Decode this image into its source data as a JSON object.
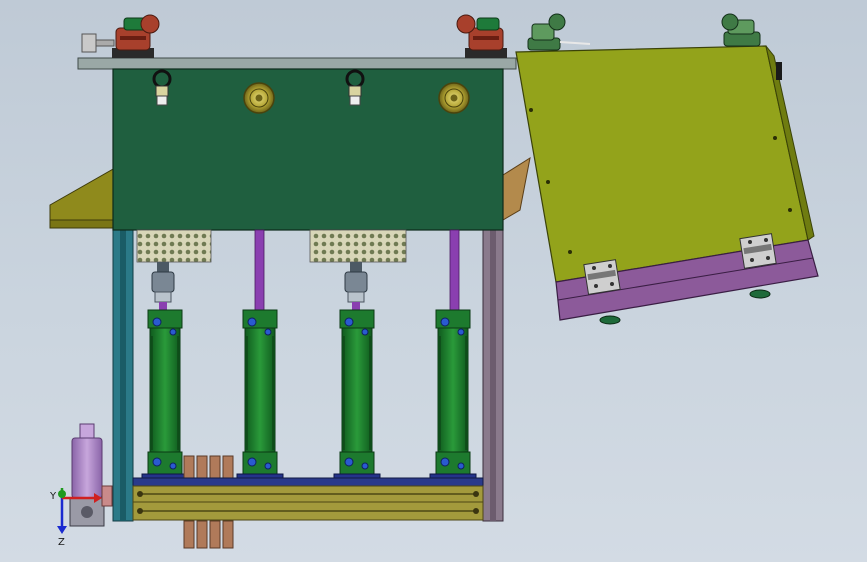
{
  "viewport": {
    "background": "#c8d2dc",
    "coordinate_triad": {
      "x_label": "",
      "y_label": "Y",
      "z_label": "Z"
    }
  },
  "colors": {
    "frame_green": "#1f5f3f",
    "lid_olive": "#93a31b",
    "cylinder_green": "#1d7a2e",
    "rod_purple": "#8a3fb0",
    "base_olive": "#a39a3c",
    "clamp_red": "#a8402c",
    "clamp_green": "#3f7a45",
    "lid_purple": "#8c5a9a",
    "knob_yellow": "#b8a830",
    "canister_purple": "#a580c0"
  },
  "model": {
    "cylinders": [
      {
        "name": "cylinder-1"
      },
      {
        "name": "cylinder-2"
      },
      {
        "name": "cylinder-3"
      },
      {
        "name": "cylinder-4"
      }
    ],
    "top_clamps": [
      {
        "name": "clamp-red-left",
        "color": "red"
      },
      {
        "name": "clamp-red-right",
        "color": "red"
      },
      {
        "name": "clamp-green-left",
        "color": "green"
      },
      {
        "name": "clamp-green-right",
        "color": "green"
      }
    ]
  }
}
